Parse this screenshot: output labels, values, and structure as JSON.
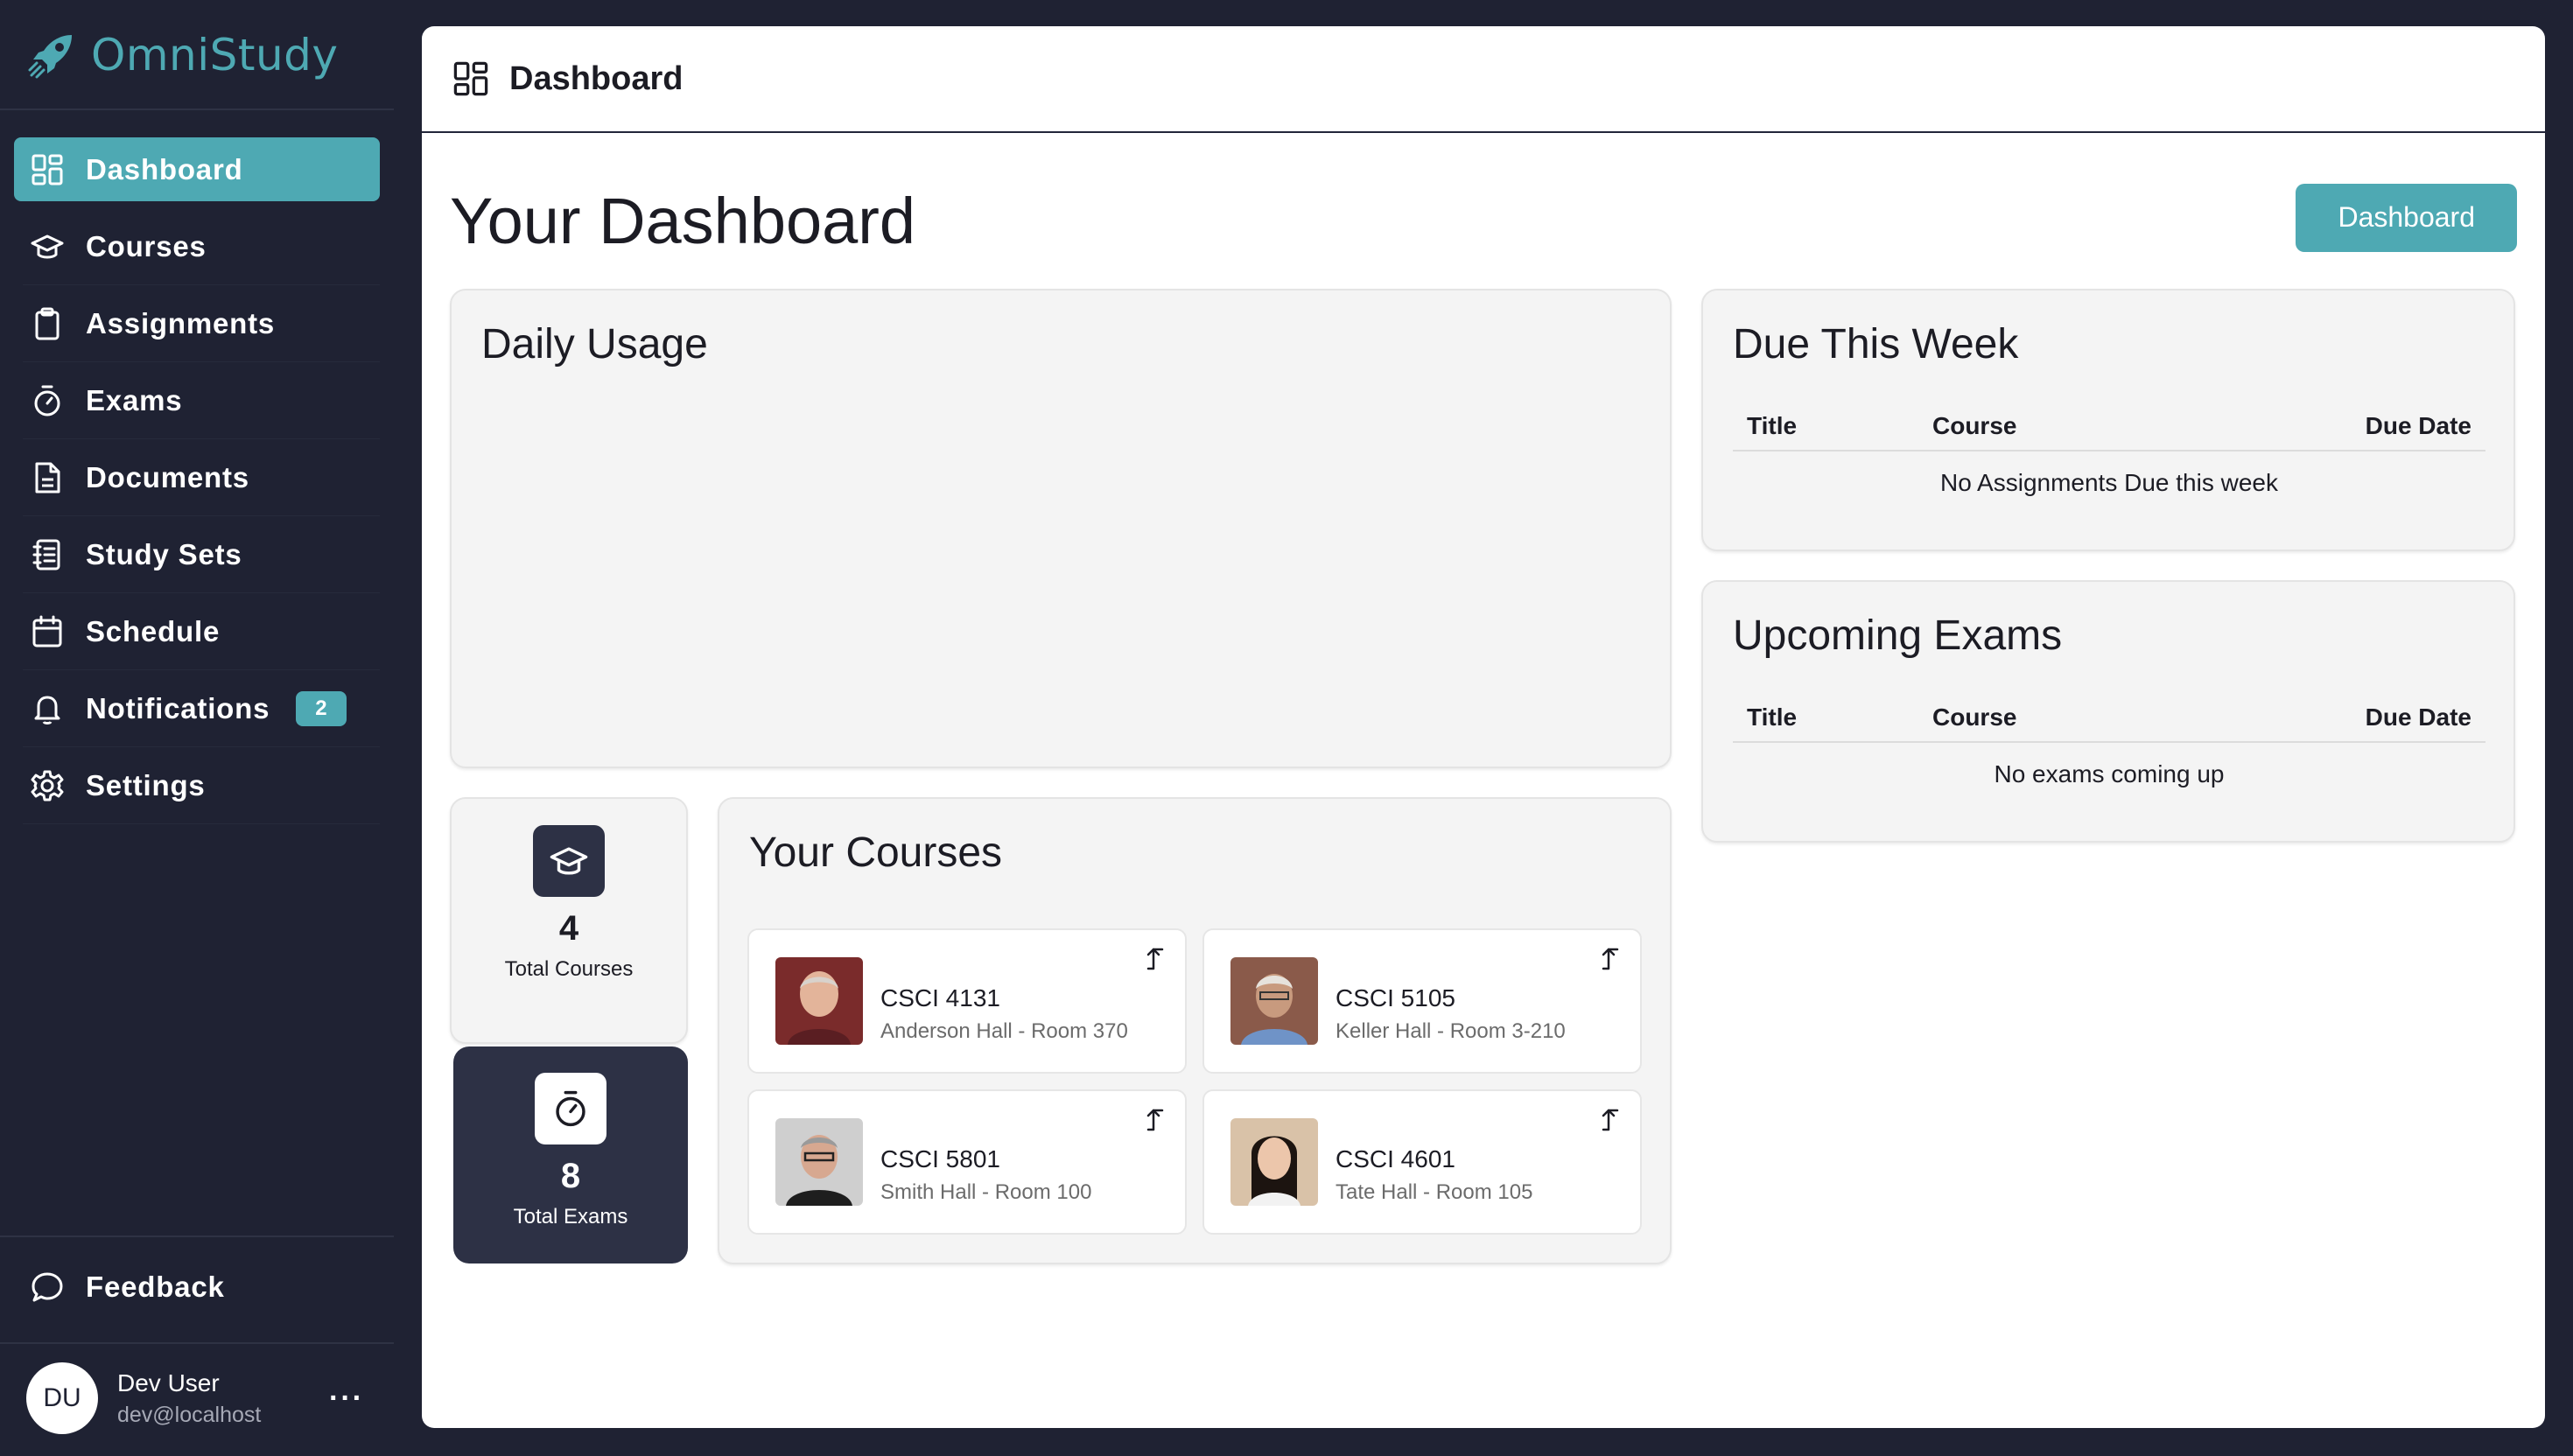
{
  "brand": {
    "name": "OmniStudy",
    "accent": "#4ea9b3"
  },
  "sidebar": {
    "items": [
      {
        "label": "Dashboard",
        "icon": "grid-icon",
        "active": true
      },
      {
        "label": "Courses",
        "icon": "graduation-cap-icon"
      },
      {
        "label": "Assignments",
        "icon": "clipboard-icon"
      },
      {
        "label": "Exams",
        "icon": "stopwatch-icon"
      },
      {
        "label": "Documents",
        "icon": "document-icon"
      },
      {
        "label": "Study Sets",
        "icon": "notebook-icon"
      },
      {
        "label": "Schedule",
        "icon": "calendar-icon"
      },
      {
        "label": "Notifications",
        "icon": "bell-icon",
        "badge": "2"
      },
      {
        "label": "Settings",
        "icon": "gear-icon"
      }
    ],
    "feedback": "Feedback",
    "user": {
      "initials": "DU",
      "name": "Dev User",
      "email": "dev@localhost",
      "more": "···"
    }
  },
  "header": {
    "title": "Dashboard",
    "icon": "grid-icon"
  },
  "page": {
    "title": "Your Dashboard",
    "button": "Dashboard"
  },
  "daily_usage": {
    "title": "Daily Usage"
  },
  "due_this_week": {
    "title": "Due This Week",
    "columns": [
      "Title",
      "Course",
      "Due Date"
    ],
    "empty": "No Assignments Due this week"
  },
  "upcoming_exams": {
    "title": "Upcoming Exams",
    "columns": [
      "Title",
      "Course",
      "Due Date"
    ],
    "empty": "No exams coming up"
  },
  "stats": {
    "courses": {
      "value": "4",
      "label": "Total Courses"
    },
    "exams": {
      "value": "8",
      "label": "Total Exams"
    }
  },
  "courses": {
    "title": "Your Courses",
    "items": [
      {
        "code": "CSCI 4131",
        "location": "Anderson Hall - Room 370"
      },
      {
        "code": "CSCI 5105",
        "location": "Keller Hall - Room 3-210"
      },
      {
        "code": "CSCI 5801",
        "location": "Smith Hall - Room 100"
      },
      {
        "code": "CSCI 4601",
        "location": "Tate Hall - Room 105"
      }
    ]
  }
}
